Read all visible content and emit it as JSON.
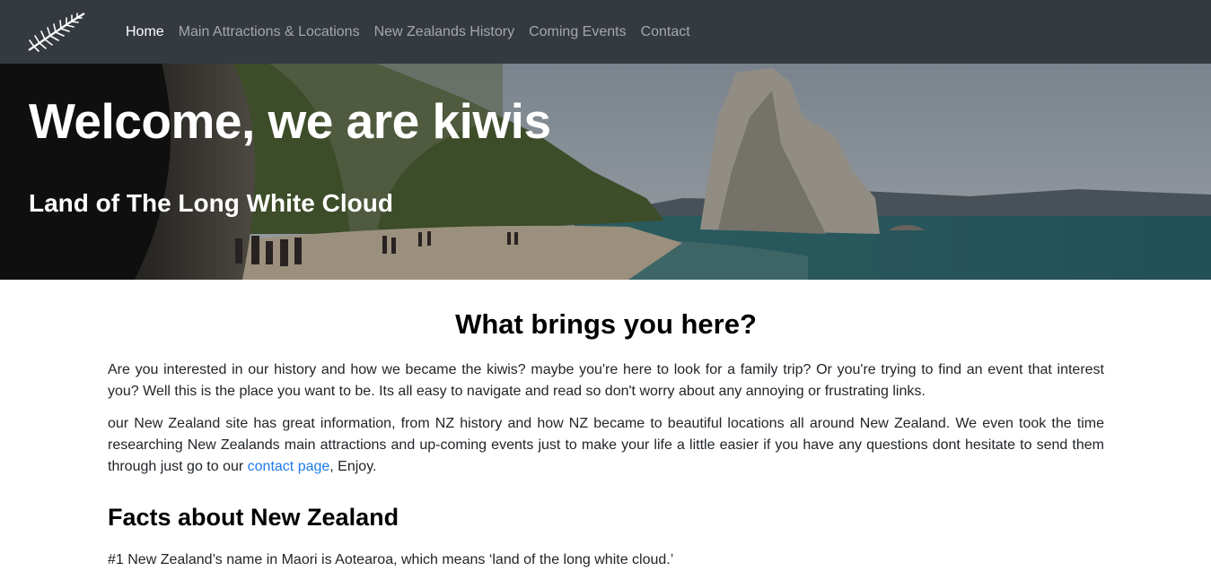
{
  "nav": {
    "logo_icon": "silver-fern-icon",
    "items": [
      {
        "label": "Home",
        "active": true
      },
      {
        "label": "Main Attractions & Locations",
        "active": false
      },
      {
        "label": "New Zealands History",
        "active": false
      },
      {
        "label": "Coming Events",
        "active": false
      },
      {
        "label": "Contact",
        "active": false
      }
    ]
  },
  "hero": {
    "title": "Welcome, we are kiwis",
    "subtitle": "Land of The Long White Cloud"
  },
  "intro": {
    "heading": "What brings you here?",
    "paragraph1": "Are you interested in our history and how we became the kiwis? maybe you're here to look for a family trip? Or you're trying to find an event that interest you? Well this is the place you want to be. Its all easy to navigate and read so don't worry about any annoying or frustrating links.",
    "paragraph2_before": "our New Zealand site has great information, from NZ history and how NZ became to beautiful locations all around New Zealand. We even took the time researching New Zealands main attractions and up-coming events just to make your life a little easier if you have any questions dont hesitate to send them through just go to our ",
    "paragraph2_link": "contact page",
    "paragraph2_after": ", Enjoy."
  },
  "facts": {
    "heading": "Facts about New Zealand",
    "items": [
      "#1 New Zealand’s name in Maori is Aotearoa, which means ‘land of the long white cloud.’"
    ]
  },
  "colors": {
    "navbar": "#343a40",
    "link": "#1e7be8"
  }
}
